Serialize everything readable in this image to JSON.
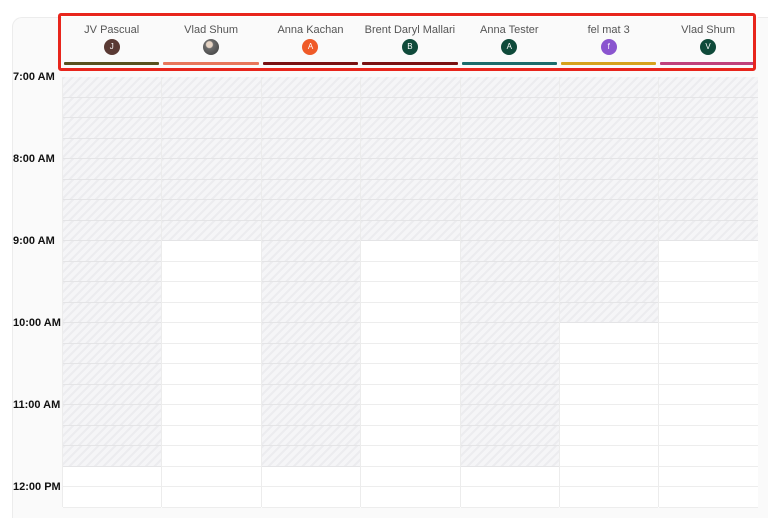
{
  "time_labels": [
    "7:00 AM",
    "8:00 AM",
    "9:00 AM",
    "10:00 AM",
    "11:00 AM",
    "12:00 PM"
  ],
  "columns": [
    {
      "name": "JV Pascual",
      "initial": "J",
      "avatar_color": "#5a3a34",
      "bar_color": "#59501e",
      "blocked_until_slot": 19
    },
    {
      "name": "Vlad Shum",
      "initial": "",
      "avatar_color": "photo",
      "bar_color": "#e8755a",
      "blocked_until_slot": 8
    },
    {
      "name": "Anna Kachan",
      "initial": "A",
      "avatar_color": "#ef5a28",
      "bar_color": "#7a1112",
      "blocked_until_slot": 19
    },
    {
      "name": "Brent Daryl Mallari",
      "initial": "B",
      "avatar_color": "#0f4a3a",
      "bar_color": "#7a1112",
      "blocked_until_slot": 8
    },
    {
      "name": "Anna Tester",
      "initial": "A",
      "avatar_color": "#0f4a3a",
      "bar_color": "#1b6b6b",
      "blocked_until_slot": 19
    },
    {
      "name": "fel mat 3",
      "initial": "f",
      "avatar_color": "#8a55cf",
      "bar_color": "#d6a21c",
      "blocked_until_slot": 12
    },
    {
      "name": "Vlad Shum",
      "initial": "V",
      "avatar_color": "#0f4a3a",
      "bar_color": "#c0407a",
      "blocked_until_slot": 8
    }
  ]
}
